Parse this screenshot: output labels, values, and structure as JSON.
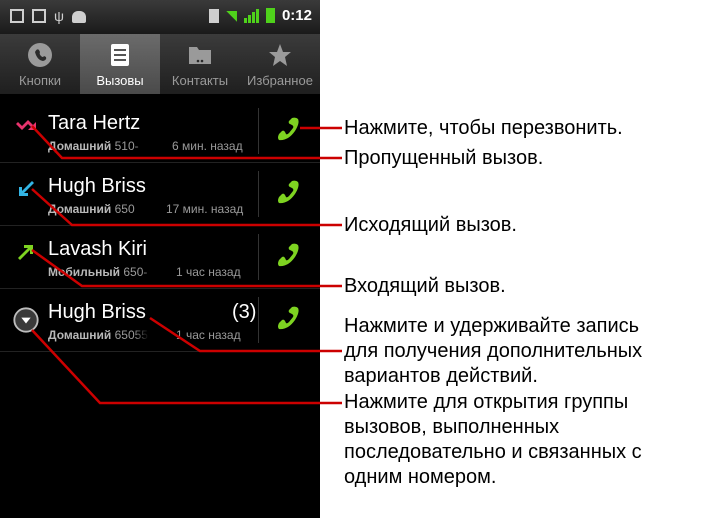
{
  "status_bar": {
    "clock": "0:12"
  },
  "tabs": [
    {
      "label": "Кнопки",
      "icon": "phone-icon"
    },
    {
      "label": "Вызовы",
      "icon": "call-log-icon"
    },
    {
      "label": "Контакты",
      "icon": "contacts-icon"
    },
    {
      "label": "Избранное",
      "icon": "star-icon"
    }
  ],
  "calls": [
    {
      "name": "Tara Hertz",
      "type_label": "Домашний",
      "number": "510-",
      "time_ago": "6 мин. назад",
      "call_type": "missed",
      "count": ""
    },
    {
      "name": "Hugh Briss",
      "type_label": "Домашний",
      "number": "650",
      "time_ago": "17 мин. назад",
      "call_type": "outgoing",
      "count": ""
    },
    {
      "name": "Lavash Kiri",
      "type_label": "Мобильный",
      "number": "650-",
      "time_ago": "1 час назад",
      "call_type": "incoming",
      "count": ""
    },
    {
      "name": "Hugh Briss",
      "type_label": "Домашний",
      "number": "65055",
      "time_ago": "1 час назад",
      "call_type": "group",
      "count": "(3)"
    }
  ],
  "annotations": {
    "callback": "Нажмите, чтобы перезвонить.",
    "missed": "Пропущенный вызов.",
    "outgoing": "Исходящий вызов.",
    "incoming": "Входящий вызов.",
    "longpress_1": "Нажмите и удерживайте запись",
    "longpress_2": "для получения дополнительных",
    "longpress_3": "вариантов действий.",
    "group_1": "Нажмите для открытия группы",
    "group_2": "вызовов, выполненных",
    "group_3": "последовательно и связанных с",
    "group_4": "одним номером."
  },
  "colors": {
    "callout_line": "#cc0000",
    "missed": "#e8336d",
    "outgoing": "#33b5e5",
    "incoming": "#7ed321",
    "dial": "#7ed321"
  }
}
